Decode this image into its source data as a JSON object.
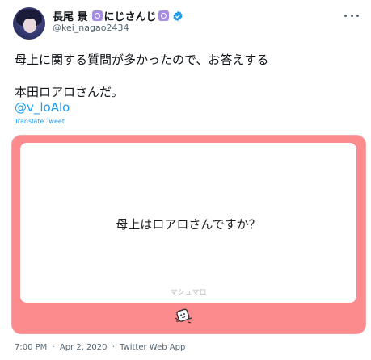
{
  "author": {
    "name": "長尾 景",
    "affiliation": "にじさんじ",
    "handle": "@kei_nagao2434"
  },
  "tweet": {
    "line1": "母上に関する質問が多かったので、お答えする",
    "line2": "本田ロアロさんだ。",
    "mention": "@v_loAlo",
    "translate_label": "Translate Tweet"
  },
  "card": {
    "question": "母上はロアロさんですか？",
    "brand": "マシュマロ"
  },
  "meta": {
    "time": "7:00 PM",
    "date": "Apr 2, 2020",
    "client": "Twitter Web App"
  },
  "colors": {
    "card_bg": "#fc8b8d",
    "link": "#1d9bf0",
    "verified": "#1d9bf0",
    "badge": "#a58de0"
  },
  "icons": {
    "more": "more-horizontal-icon",
    "verified": "verified-badge-icon",
    "marshmallow": "marshmallow-icon"
  }
}
